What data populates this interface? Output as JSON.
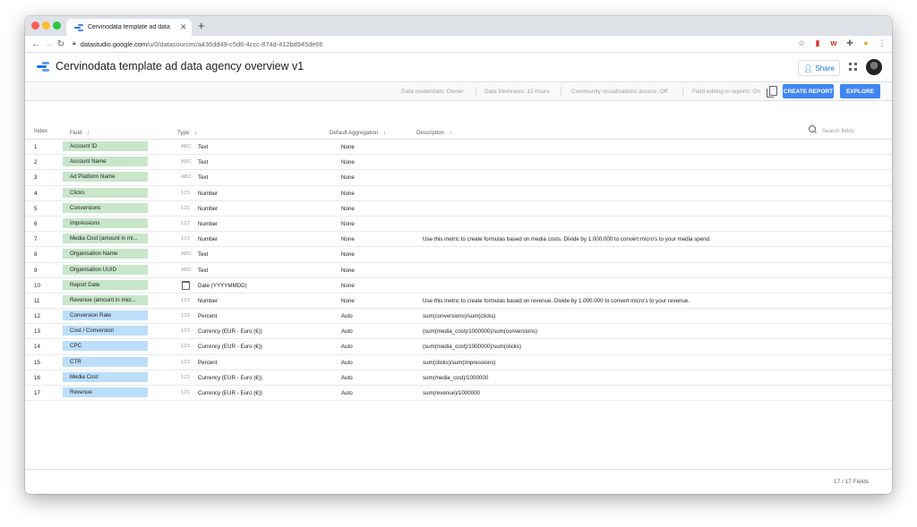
{
  "browser": {
    "tab_title": "Cervinodata template ad data",
    "url_host": "datastudio.google.com",
    "url_path": "/u/0/datasources/a436dd49-c5d6-4ccc-874d-412bd945de66"
  },
  "header": {
    "title": "Cervinodata template ad data agency overview v1",
    "share_label": "Share"
  },
  "infobar": {
    "credentials": "Data credentials: Owner",
    "freshness": "Data freshness: 12 hours",
    "community": "Community visualisations access: Off",
    "field_editing": "Field editing in reports: On",
    "create_report": "CREATE REPORT",
    "explore": "EXPLORE"
  },
  "table": {
    "headers": {
      "index": "Index",
      "field": "Field",
      "type": "Type",
      "aggregation": "Default Aggregation",
      "description": "Description"
    },
    "search_placeholder": "Search fields",
    "rows": [
      {
        "index": "1",
        "field": "Account ID",
        "kind": "dim",
        "type_icon": "ABC",
        "type": "Text",
        "agg": "None",
        "desc": ""
      },
      {
        "index": "2",
        "field": "Account Name",
        "kind": "dim",
        "type_icon": "ABC",
        "type": "Text",
        "agg": "None",
        "desc": ""
      },
      {
        "index": "3",
        "field": "Ad Platform Name",
        "kind": "dim",
        "type_icon": "ABC",
        "type": "Text",
        "agg": "None",
        "desc": ""
      },
      {
        "index": "4",
        "field": "Clicks",
        "kind": "dim",
        "type_icon": "123",
        "type": "Number",
        "agg": "None",
        "desc": ""
      },
      {
        "index": "5",
        "field": "Conversions",
        "kind": "dim",
        "type_icon": "123",
        "type": "Number",
        "agg": "None",
        "desc": ""
      },
      {
        "index": "6",
        "field": "Impressions",
        "kind": "dim",
        "type_icon": "123",
        "type": "Number",
        "agg": "None",
        "desc": ""
      },
      {
        "index": "7",
        "field": "Media Cost (amount in mi...",
        "kind": "dim",
        "type_icon": "123",
        "type": "Number",
        "agg": "None",
        "desc": "Use this metric to create formulas based on media costs. Divide by 1.000.000 to convert micro's to your media spend."
      },
      {
        "index": "8",
        "field": "Organisation Name",
        "kind": "dim",
        "type_icon": "ABC",
        "type": "Text",
        "agg": "None",
        "desc": ""
      },
      {
        "index": "9",
        "field": "Organisation UUID",
        "kind": "dim",
        "type_icon": "ABC",
        "type": "Text",
        "agg": "None",
        "desc": ""
      },
      {
        "index": "10",
        "field": "Report Date",
        "kind": "dim",
        "type_icon": "calendar",
        "type": "Date (YYYYMMDD)",
        "agg": "None",
        "desc": ""
      },
      {
        "index": "11",
        "field": "Revenue (amount in micr...",
        "kind": "dim",
        "type_icon": "123",
        "type": "Number",
        "agg": "None",
        "desc": "Use this metric to create formulas based on revenue. Divide by 1.000.000 to convert micro's to your revenue."
      },
      {
        "index": "12",
        "field": "Conversion Rate",
        "kind": "met",
        "type_icon": "123",
        "type": "Percent",
        "agg": "Auto",
        "desc": "sum(conversions)/sum(clicks)"
      },
      {
        "index": "13",
        "field": "Cost / Conversion",
        "kind": "met",
        "type_icon": "123",
        "type": "Currency (EUR - Euro (€))",
        "agg": "Auto",
        "desc": "(sum(media_cost)/1000000)/sum(conversions)"
      },
      {
        "index": "14",
        "field": "CPC",
        "kind": "met",
        "type_icon": "123",
        "type": "Currency (EUR - Euro (€))",
        "agg": "Auto",
        "desc": "(sum(media_cost)/1000000)/sum(clicks)"
      },
      {
        "index": "15",
        "field": "CTR",
        "kind": "met",
        "type_icon": "123",
        "type": "Percent",
        "agg": "Auto",
        "desc": "sum(clicks)/sum(impressions)"
      },
      {
        "index": "16",
        "field": "Media Cost",
        "kind": "met",
        "type_icon": "123",
        "type": "Currency (EUR - Euro (€))",
        "agg": "Auto",
        "desc": "sum(media_cost)/1000000"
      },
      {
        "index": "17",
        "field": "Revenue",
        "kind": "met",
        "type_icon": "123",
        "type": "Currency (EUR - Euro (€))",
        "agg": "Auto",
        "desc": "sum(revenue)/1000000"
      }
    ]
  },
  "footer": {
    "field_count": "17 / 17 Fields"
  },
  "colors": {
    "dimension_chip": "#c8e6c9",
    "metric_chip": "#bbdefb",
    "accent": "#4285f4"
  }
}
